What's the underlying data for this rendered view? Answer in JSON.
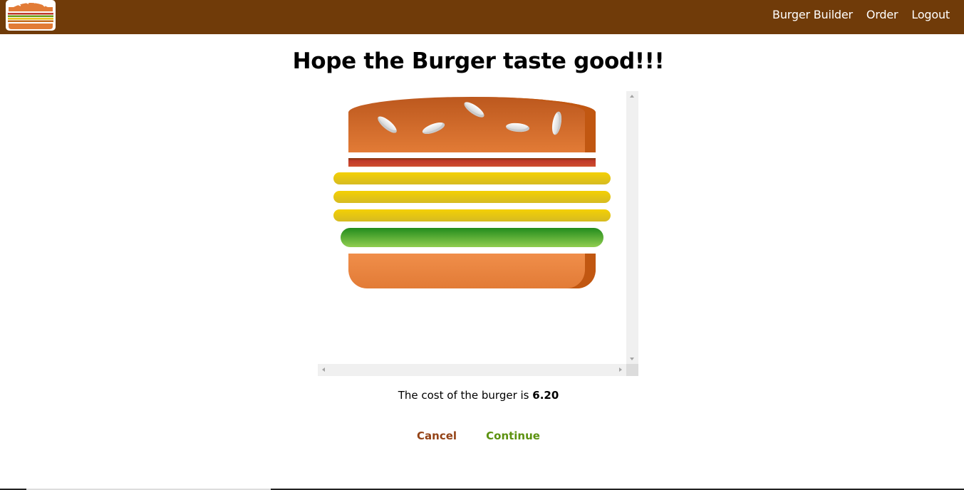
{
  "toolbar": {
    "background": "#703b09",
    "logo_icon": "burger-logo",
    "nav": [
      {
        "label": "Burger Builder"
      },
      {
        "label": "Order"
      },
      {
        "label": "Logout"
      }
    ]
  },
  "main": {
    "heading": "Hope the Burger taste good!!!",
    "burger": {
      "layers": [
        "bread-top",
        "meat",
        "cheese",
        "cheese",
        "cheese",
        "salad",
        "bread-bottom"
      ]
    },
    "cost_label": "The cost of the burger is",
    "cost_value": "6.20",
    "cancel_label": "Cancel",
    "continue_label": "Continue"
  },
  "colors": {
    "cancel": "#944317",
    "continue": "#5c9210",
    "bread": "#e27b36",
    "cheese": "#f4d004",
    "salad": "#228c1d",
    "meat": "#c0392b"
  }
}
